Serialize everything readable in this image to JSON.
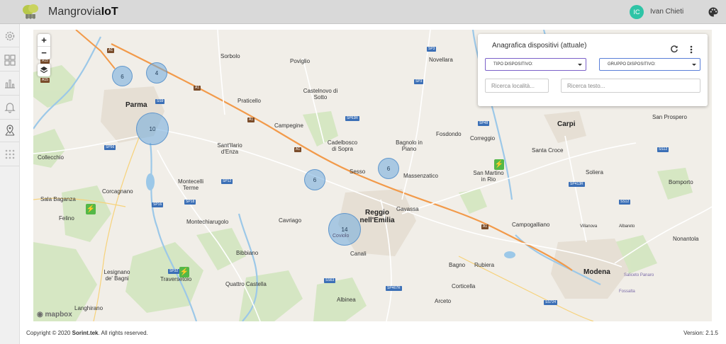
{
  "header": {
    "brand_main": "Mangrovia",
    "brand_suffix": "IoT",
    "user_initials": "IC",
    "user_name": "Ivan Chieti",
    "icons": [
      "app-logo",
      "palette-icon"
    ]
  },
  "sidebar": {
    "items": [
      {
        "icon": "gear-icon"
      },
      {
        "icon": "dashboard-grid-icon"
      },
      {
        "icon": "bar-chart-icon"
      },
      {
        "icon": "bell-icon"
      },
      {
        "icon": "map-pin-icon",
        "active": true
      },
      {
        "icon": "apps-grid-icon"
      }
    ]
  },
  "map": {
    "zoom_in": "+",
    "zoom_out": "−",
    "attribution": "mapbox",
    "clusters": [
      "6",
      "4",
      "10",
      "6",
      "6",
      "14"
    ],
    "cluster_sublabel": "Coviolo",
    "towns_big": [
      "Parma",
      "Reggio nell'Emilia",
      "Carpi",
      "Modena"
    ],
    "towns": [
      "Sorbolo",
      "Poviglio",
      "Novellara",
      "Praticello",
      "Castelnovo di Sotto",
      "Campegine",
      "Cadelbosco di Sopra",
      "Bagnolo in Piano",
      "Fosdondo",
      "Correggio",
      "San Prospero",
      "Sant'Ilario d'Enza",
      "Santa Croce",
      "Collecchio",
      "Sesso",
      "Massenzatico",
      "San Martino in Rio",
      "Soliera",
      "Montecelli Terme",
      "Bomporto",
      "Corcagnano",
      "Sala Baganza",
      "Felino",
      "Gavassa",
      "Cavriago",
      "Montechiarugolo",
      "Campogalliano",
      "Villanova",
      "Albareto",
      "Nonantola",
      "Bibbiano",
      "Canali",
      "Lesignano de' Bagni",
      "Traversetolo",
      "Quattro Castella",
      "Bagno",
      "Rubiera",
      "Corticella",
      "Saliceto Panaro",
      "Fossalta",
      "Albinea",
      "Arceto",
      "Langhirano"
    ],
    "road_labels": [
      "A1",
      "A15",
      "A15",
      "SP3",
      "SP3",
      "SS9",
      "SP63R",
      "SP48",
      "A1",
      "A1",
      "A1",
      "SP56",
      "SP12",
      "SP18",
      "SP16",
      "SP413R",
      "SS12",
      "SS12",
      "A1",
      "SP32",
      "SS63",
      "SP467R",
      "SS724"
    ]
  },
  "panel": {
    "title": "Anagrafica dispositivi (attuale)",
    "tipo_label": "TIPO DISPOSITIVO:",
    "gruppo_label": "GRUPPO DISPOSITIVO:",
    "search_location_placeholder": "Ricerca località...",
    "search_text_placeholder": "Ricerca testo...",
    "icons": [
      "refresh-icon",
      "more-vert-icon"
    ]
  },
  "footer": {
    "copyright_prefix": "Copyright © 2020 ",
    "copyright_company": "Sorint.tek",
    "copyright_suffix": ". All rights reserved.",
    "version": "Version: 2.1.5"
  }
}
